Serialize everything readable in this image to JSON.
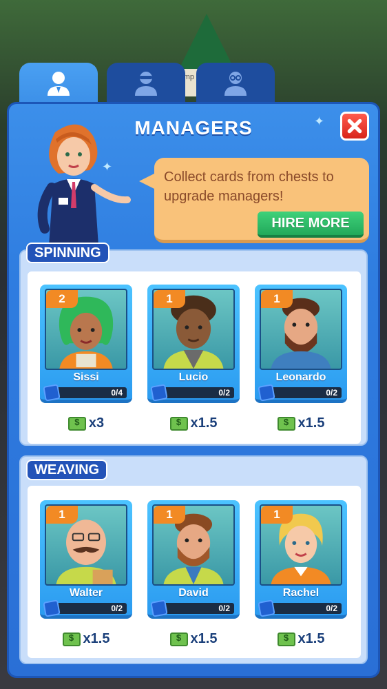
{
  "tabs": [
    {
      "icon": "manager-icon",
      "active": true
    },
    {
      "icon": "suited-manager-icon",
      "active": false
    },
    {
      "icon": "glasses-manager-icon",
      "active": false
    }
  ],
  "background_sign": "mp de",
  "title": "MANAGERS",
  "bubble": {
    "text": "Collect cards from chests to upgrade managers!",
    "hire_label": "HIRE MORE"
  },
  "sections": [
    {
      "label": "SPINNING",
      "managers": [
        {
          "level": "2",
          "name": "Sissi",
          "progress": "0/4",
          "bonus": "x3"
        },
        {
          "level": "1",
          "name": "Lucio",
          "progress": "0/2",
          "bonus": "x1.5"
        },
        {
          "level": "1",
          "name": "Leonardo",
          "progress": "0/2",
          "bonus": "x1.5"
        }
      ]
    },
    {
      "label": "WEAVING",
      "managers": [
        {
          "level": "1",
          "name": "Walter",
          "progress": "0/2",
          "bonus": "x1.5"
        },
        {
          "level": "1",
          "name": "David",
          "progress": "0/2",
          "bonus": "x1.5"
        },
        {
          "level": "1",
          "name": "Rachel",
          "progress": "0/2",
          "bonus": "x1.5"
        }
      ]
    }
  ],
  "colors": {
    "panel": "#3c8fea",
    "tab_active": "#4aa0f2",
    "tab_inactive": "#1e4d9e",
    "level_badge": "#f28a24",
    "hire_button": "#22a95a",
    "close_button": "#d8241a"
  }
}
